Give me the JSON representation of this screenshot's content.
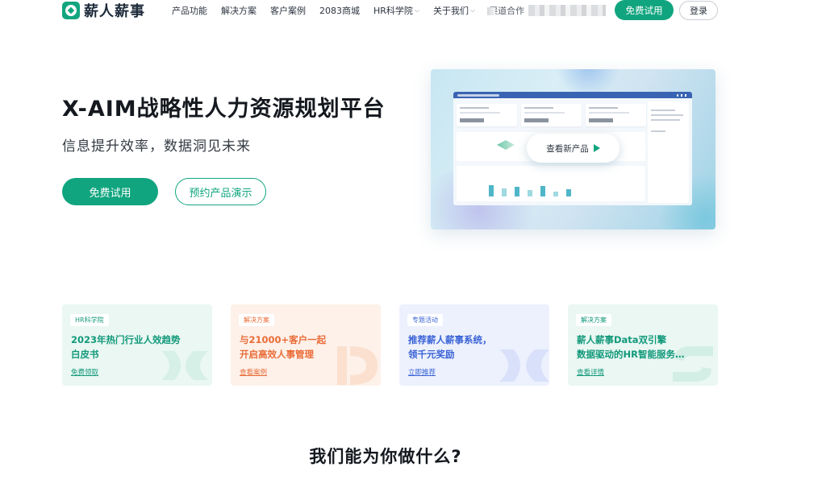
{
  "brand": {
    "name": "薪人薪事"
  },
  "nav": {
    "items": [
      {
        "label": "产品功能"
      },
      {
        "label": "解决方案"
      },
      {
        "label": "客户案例"
      },
      {
        "label": "2083商城"
      },
      {
        "label": "HR科学院"
      },
      {
        "label": "关于我们"
      },
      {
        "label": "渠道合作"
      }
    ],
    "trial_label": "免费试用",
    "login_label": "登录"
  },
  "hero": {
    "title": "X-AIM战略性人力资源规划平台",
    "subtitle": "信息提升效率，数据洞见未来",
    "trial_label": "免费试用",
    "demo_label": "预约产品演示",
    "preview_cta": "查看新产品"
  },
  "cards": [
    {
      "tag": "HR科学院",
      "title_lines": [
        "2023年热门行业人效趋势",
        "白皮书"
      ],
      "link": "免费领取",
      "accent": "#12997a",
      "bg": "#eaf7f3"
    },
    {
      "tag": "解决方案",
      "title_lines": [
        "与21000+客户一起",
        "开启高效人事管理"
      ],
      "link": "查看案例",
      "accent": "#ea6c37",
      "bg": "#fdf1ea"
    },
    {
      "tag": "专题活动",
      "title_lines": [
        "推荐薪人薪事系统，",
        "领千元奖励"
      ],
      "link": "立即推荐",
      "accent": "#3a63d6",
      "bg": "#edf1fd"
    },
    {
      "tag": "解决方案",
      "title_lines": [
        "薪人薪事Data双引擎",
        "数据驱动的HR智能服务…"
      ],
      "link": "查看详情",
      "accent": "#12997a",
      "bg": "#eaf7f3"
    }
  ],
  "section": {
    "title": "我们能为你做什么?"
  },
  "colors": {
    "brand": "#11a57f",
    "text": "#15191f"
  }
}
